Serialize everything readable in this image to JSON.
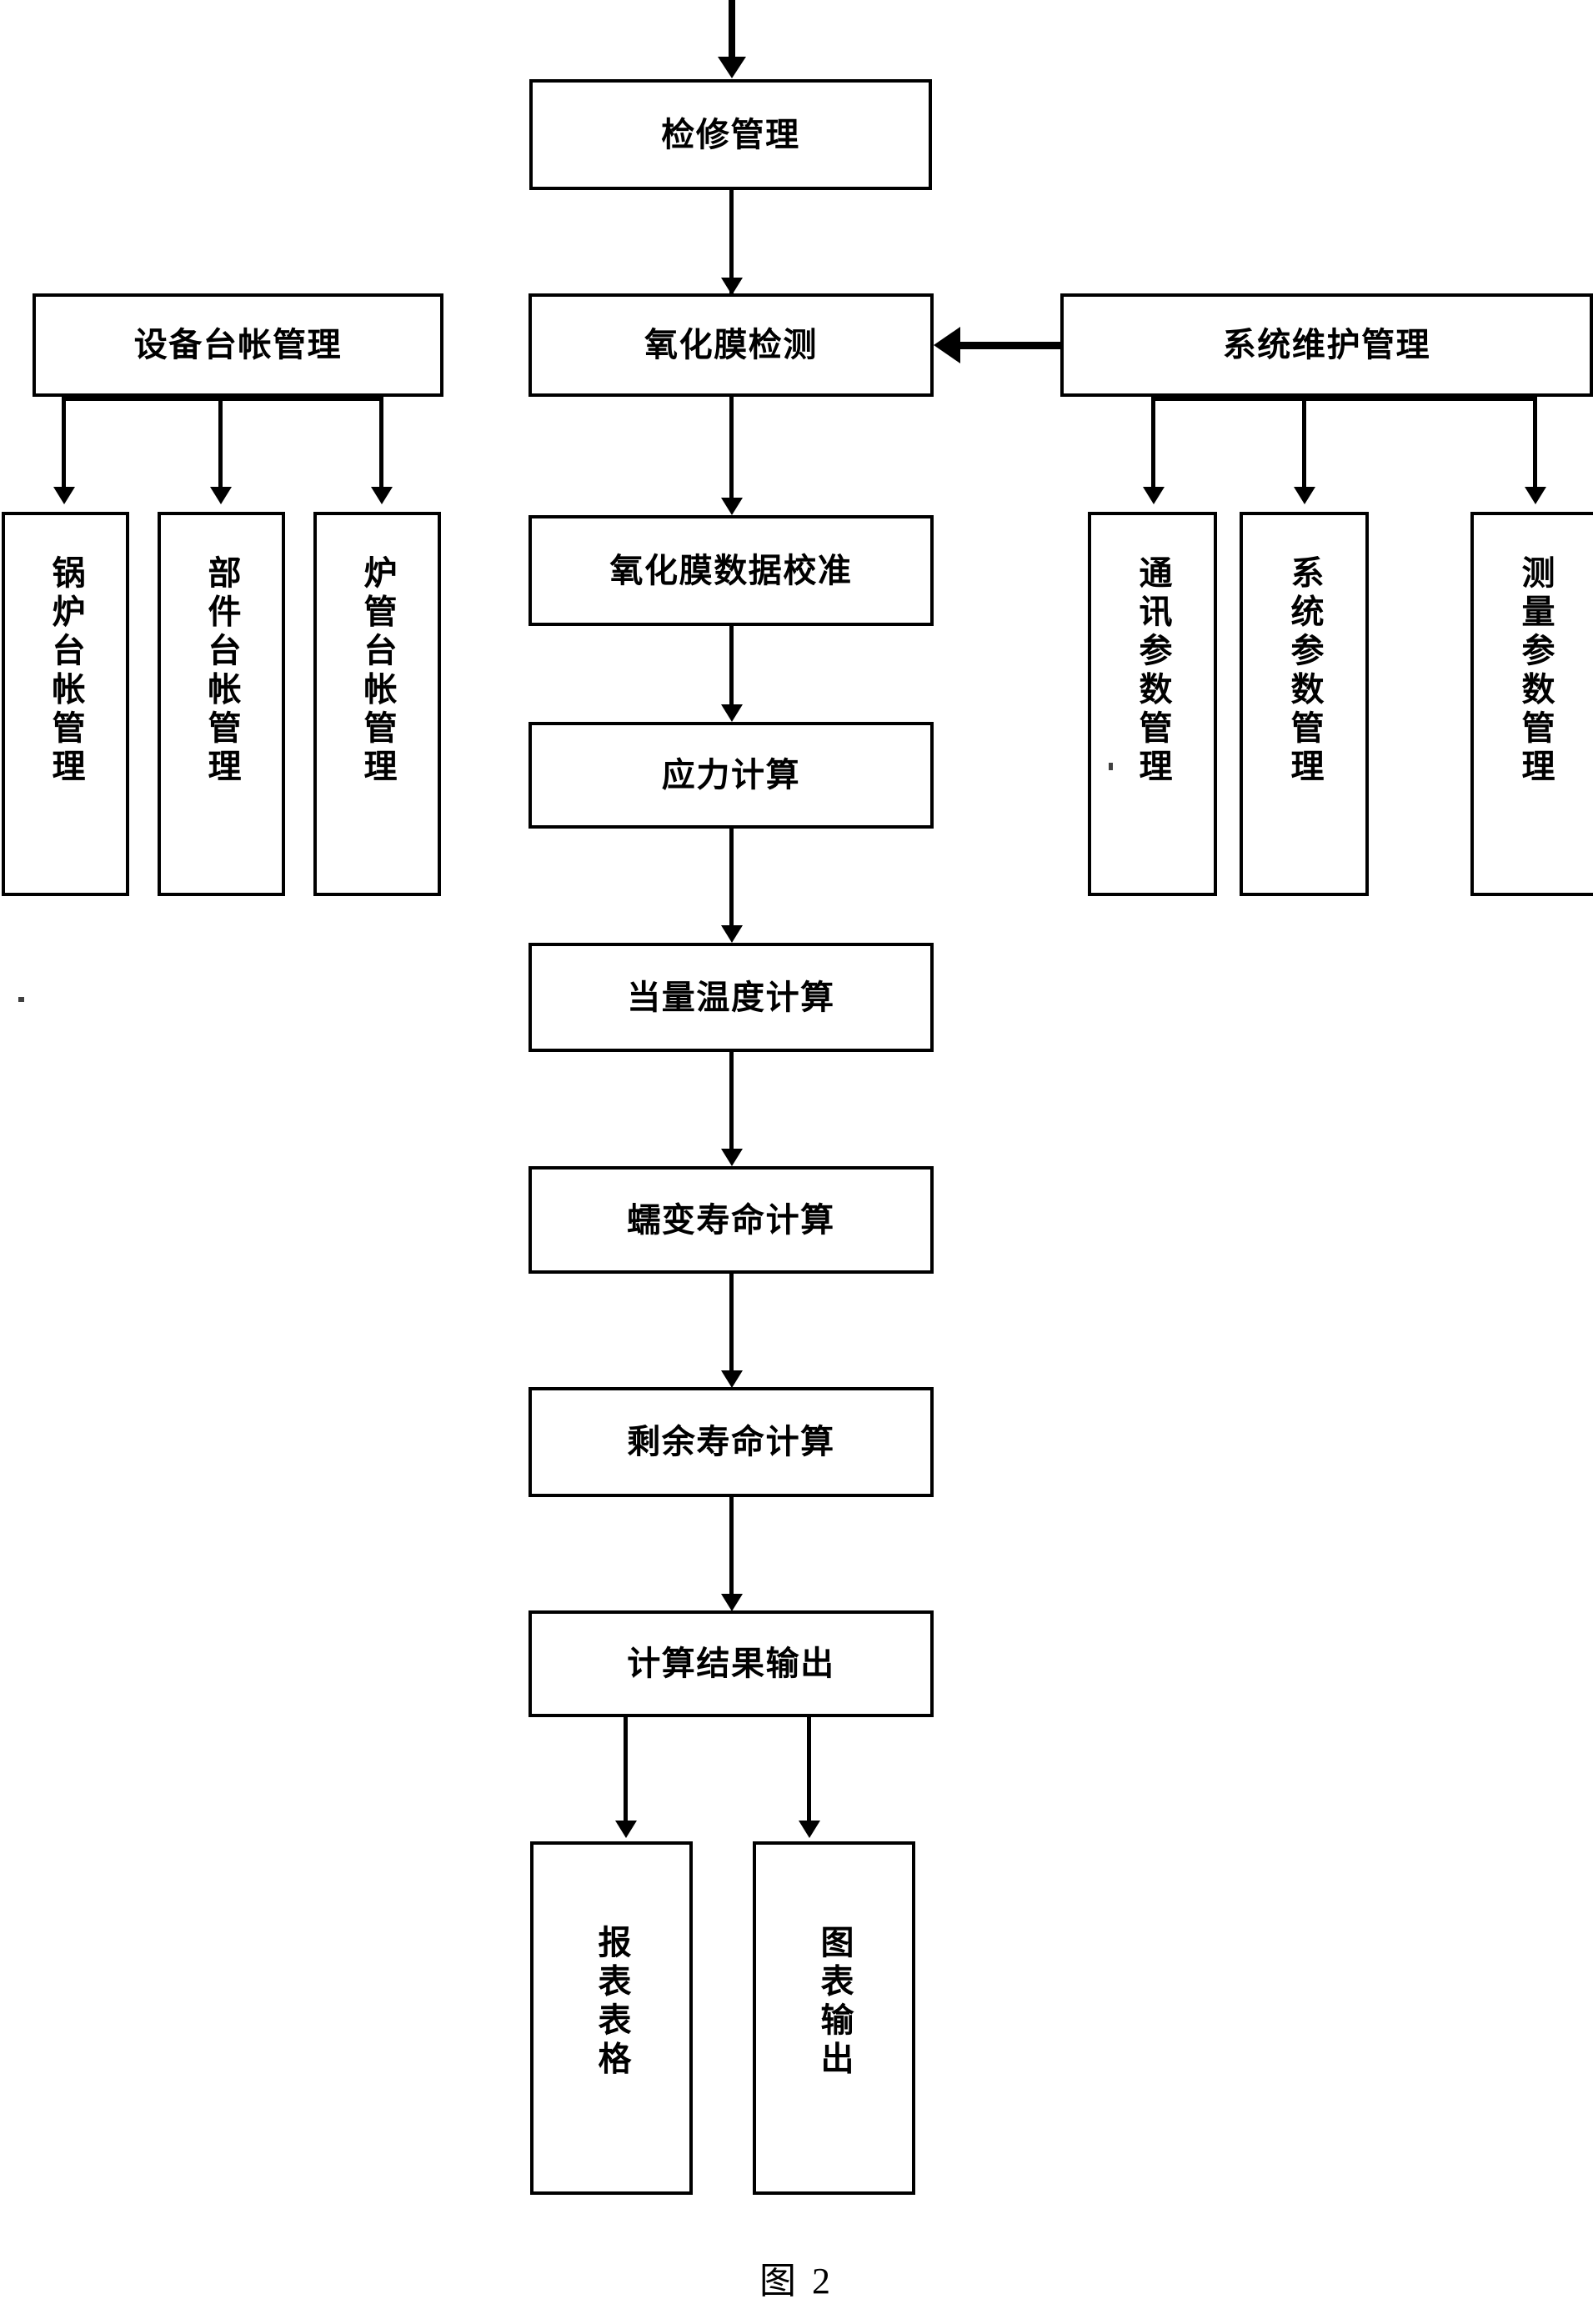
{
  "figure": {
    "caption": "图 2",
    "type": "flowchart",
    "language": "zh-CN",
    "line_color": "#000000",
    "background_color": "#ffffff"
  },
  "nodes": {
    "maintenance_management": "检修管理",
    "equipment_ledger_management": "设备台帐管理",
    "oxide_film_detection": "氧化膜检测",
    "system_maintenance_management": "系统维护管理",
    "boiler_ledger_management": "锅炉台帐管理",
    "component_ledger_management": "部件台帐管理",
    "furnace_tube_ledger_management": "炉管台帐管理",
    "communication_parameter_management": "通讯参数管理",
    "system_parameter_management": "系统参数管理",
    "measurement_parameter_management": "测量参数管理",
    "oxide_film_data_calibration": "氧化膜数据校准",
    "stress_calculation": "应力计算",
    "equivalent_temperature_calculation": "当量温度计算",
    "creep_life_calculation": "蠕变寿命计算",
    "remaining_life_calculation": "剩余寿命计算",
    "calculation_result_output": "计算结果输出",
    "report_table": "报表表格",
    "chart_output": "图表输出"
  },
  "edges": [
    {
      "from": "(external-top)",
      "to": "maintenance_management"
    },
    {
      "from": "maintenance_management",
      "to": "oxide_film_detection"
    },
    {
      "from": "system_maintenance_management",
      "to": "oxide_film_detection"
    },
    {
      "from": "equipment_ledger_management",
      "to": "boiler_ledger_management"
    },
    {
      "from": "equipment_ledger_management",
      "to": "component_ledger_management"
    },
    {
      "from": "equipment_ledger_management",
      "to": "furnace_tube_ledger_management"
    },
    {
      "from": "system_maintenance_management",
      "to": "communication_parameter_management"
    },
    {
      "from": "system_maintenance_management",
      "to": "system_parameter_management"
    },
    {
      "from": "system_maintenance_management",
      "to": "measurement_parameter_management"
    },
    {
      "from": "oxide_film_detection",
      "to": "oxide_film_data_calibration"
    },
    {
      "from": "oxide_film_data_calibration",
      "to": "stress_calculation"
    },
    {
      "from": "stress_calculation",
      "to": "equivalent_temperature_calculation"
    },
    {
      "from": "equivalent_temperature_calculation",
      "to": "creep_life_calculation"
    },
    {
      "from": "creep_life_calculation",
      "to": "remaining_life_calculation"
    },
    {
      "from": "remaining_life_calculation",
      "to": "calculation_result_output"
    },
    {
      "from": "calculation_result_output",
      "to": "report_table"
    },
    {
      "from": "calculation_result_output",
      "to": "chart_output"
    }
  ]
}
